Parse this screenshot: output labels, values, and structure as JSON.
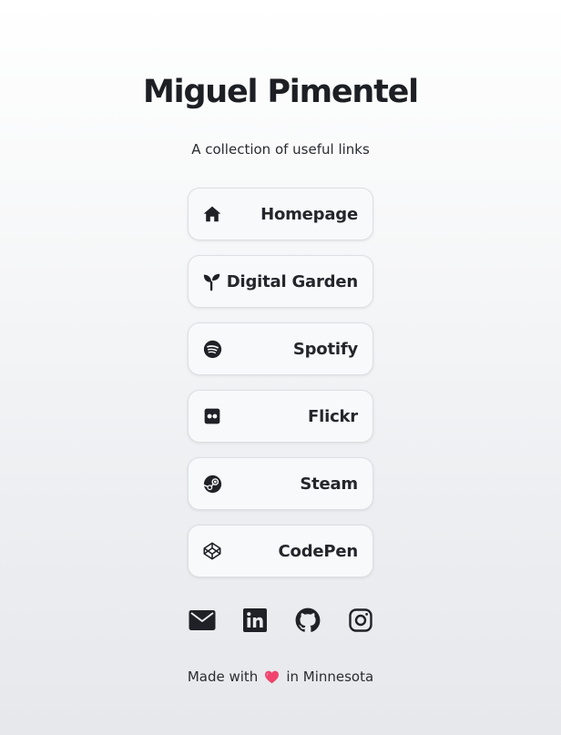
{
  "profile": {
    "name": "Miguel Pimentel",
    "tagline": "A collection of useful links"
  },
  "links": [
    {
      "label": "Homepage",
      "icon": "home-icon"
    },
    {
      "label": "Digital Garden",
      "icon": "sprout-icon"
    },
    {
      "label": "Spotify",
      "icon": "spotify-icon"
    },
    {
      "label": "Flickr",
      "icon": "flickr-icon"
    },
    {
      "label": "Steam",
      "icon": "steam-icon"
    },
    {
      "label": "CodePen",
      "icon": "codepen-icon"
    }
  ],
  "socials": [
    {
      "icon": "mail-icon"
    },
    {
      "icon": "linkedin-icon"
    },
    {
      "icon": "github-icon"
    },
    {
      "icon": "instagram-icon"
    }
  ],
  "footer": {
    "prefix": "Made with",
    "suffix": "in Minnesota",
    "heart_icon": "heart-icon"
  },
  "colors": {
    "text": "#1f2127",
    "button_bg": "#f8f9fa",
    "button_border": "#dcdfe3",
    "heart": "#f0446e"
  }
}
